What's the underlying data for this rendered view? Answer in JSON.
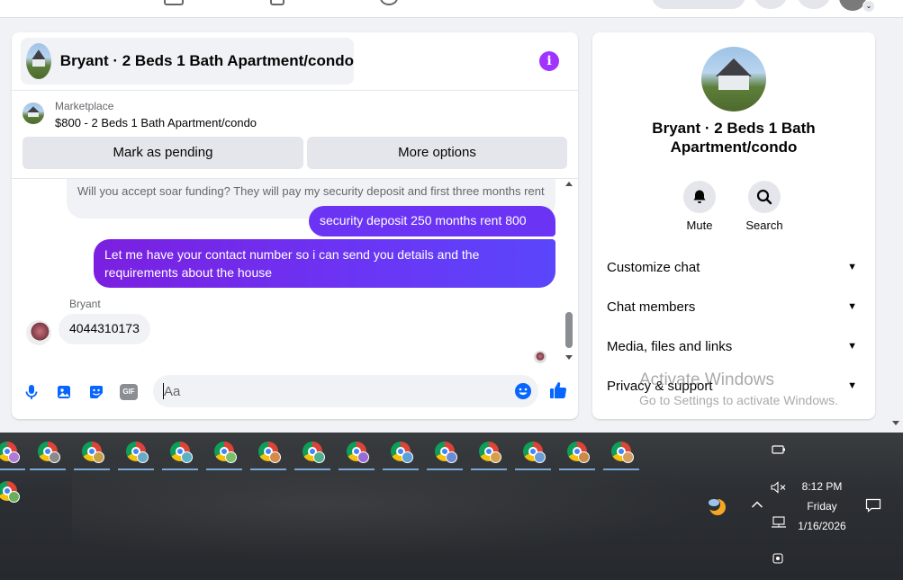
{
  "conversation": {
    "title": "Bryant · 2 Beds 1 Bath Apartment/condo",
    "info_icon": "info-icon"
  },
  "listing": {
    "category": "Marketplace",
    "description": "$800 - 2 Beds 1 Bath Apartment/condo",
    "mark_pending_label": "Mark as pending",
    "more_options_label": "More options"
  },
  "messages": [
    {
      "direction": "incoming",
      "text": "Will you accept soar funding? They will pay my security deposit and first three months rent"
    },
    {
      "direction": "outgoing",
      "text": "security deposit  250 months rent 800"
    },
    {
      "direction": "outgoing",
      "text": "Let me have your contact number so i can send you details and the requirements about the house"
    },
    {
      "direction": "incoming",
      "sender": "Bryant",
      "text": "4044310173"
    }
  ],
  "composer": {
    "placeholder": "Aa",
    "icons": [
      "microphone-icon",
      "photo-icon",
      "sticker-icon",
      "gif-icon",
      "emoji-icon",
      "thumbs-up-icon"
    ],
    "gif_label": "GIF"
  },
  "side_panel": {
    "title": "Bryant · 2 Beds 1 Bath Apartment/condo",
    "actions": [
      {
        "label": "Mute",
        "icon": "bell-icon"
      },
      {
        "label": "Search",
        "icon": "search-icon"
      }
    ],
    "sections": [
      {
        "label": "Customize chat"
      },
      {
        "label": "Chat members"
      },
      {
        "label": "Media, files and links"
      },
      {
        "label": "Privacy & support"
      }
    ]
  },
  "watermark": {
    "line1": "Activate Windows",
    "line2": "Go to Settings to activate Windows."
  },
  "taskbar": {
    "app_count": 16,
    "time": "8:12 PM",
    "day": "Friday",
    "date": "1/16/2026"
  },
  "colors": {
    "accent_purple": "#a033ff",
    "outgoing_bubble": "#6b34f5",
    "link_blue": "#0866ff",
    "panel_bg": "#f0f2f5"
  }
}
